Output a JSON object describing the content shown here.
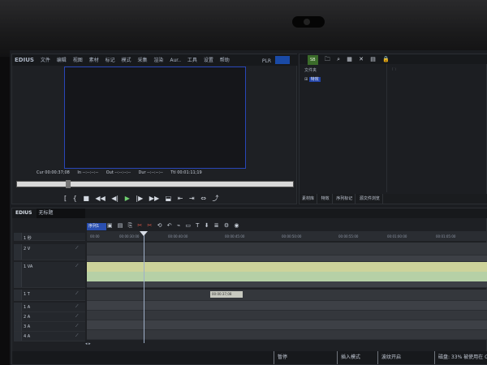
{
  "app": {
    "logo": "EDIUS",
    "menus": [
      "文件",
      "编辑",
      "视图",
      "素材",
      "标记",
      "模式",
      "采集",
      "渲染",
      "Aur..",
      "工具",
      "设置",
      "帮助"
    ],
    "plr_label": "PLR"
  },
  "player": {
    "timecodes": {
      "cur": "Cur 00:00:37;08",
      "in": "In --:--:--:--",
      "out": "Out --:--:--:--",
      "dur": "Dur --:--:--:--",
      "ttl": "Ttl 00:01:11;19"
    },
    "transport": [
      "[",
      "{",
      "■",
      "◀◀",
      "◀|",
      "▶",
      "|▶",
      "▶▶",
      "⬓",
      "⇤",
      "⇥",
      "⇔",
      "⤴"
    ]
  },
  "bin": {
    "tab_badge": "SB",
    "tool_icons": [
      "folder-icon",
      "search-icon",
      "view-icon",
      "close-icon",
      "grid-icon",
      "lock-icon"
    ],
    "tree_header": "文件夹",
    "tree_item": "特效",
    "list_header": "",
    "tabs": [
      "素材库",
      "特效",
      "序列标记",
      "源文件浏览"
    ]
  },
  "timeline": {
    "logo": "EDIUS",
    "project_name": "无标题",
    "sequence_tab": "序列1",
    "toolbar": [
      "□",
      "▣",
      "▤",
      "⎘",
      "✂",
      "✂",
      "⟲",
      "↶",
      "⌁",
      "▭",
      "T",
      "⬇",
      "≣",
      "⚙",
      "◉"
    ],
    "tracks": [
      {
        "label": "1 秒"
      },
      {
        "label": "2 V"
      },
      {
        "label": "1 VA"
      },
      {
        "label": "1 T"
      },
      {
        "label": "1 A"
      },
      {
        "label": "2 A"
      },
      {
        "label": "3 A"
      },
      {
        "label": "4 A"
      }
    ],
    "ruler_labels": [
      "00:00",
      "00:00:30:00",
      "00:00:40:00",
      "00:00:45:00",
      "00:00:50:00",
      "00:00:55:00",
      "00:01:00:00",
      "00:01:05:00"
    ],
    "tooltip": "00:00:37;08"
  },
  "status": {
    "pause": "暂停",
    "insert_mode": "插入模式",
    "ripple": "波纹开启",
    "disk": "磁盘: 33% 被使用在 C:"
  }
}
